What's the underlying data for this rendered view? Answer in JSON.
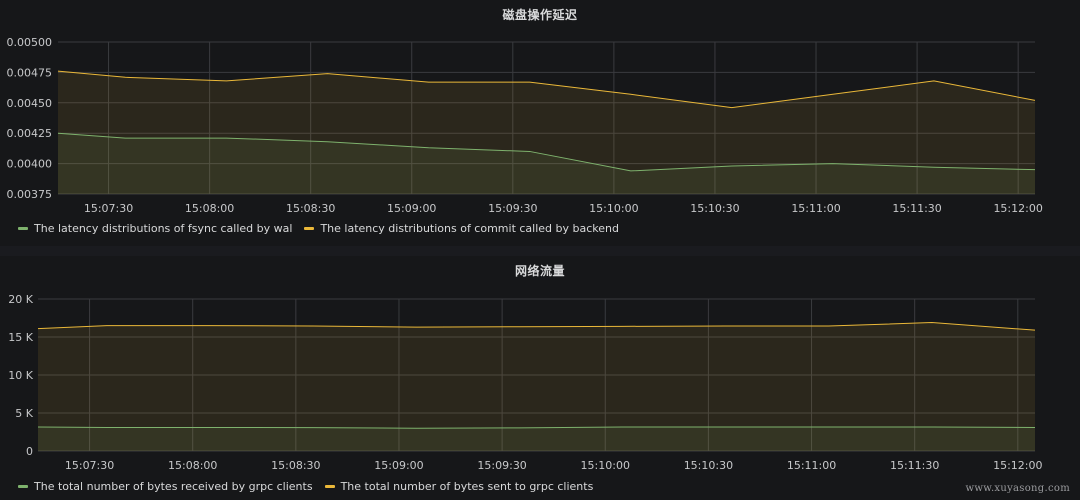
{
  "chart_data": [
    {
      "type": "area",
      "title": "磁盘操作延迟",
      "x": [
        "15:07:15",
        "15:07:30",
        "15:07:45",
        "15:08:00",
        "15:08:15",
        "15:08:30",
        "15:08:45",
        "15:09:00",
        "15:09:15",
        "15:09:30",
        "15:09:45",
        "15:10:00",
        "15:10:15",
        "15:10:30",
        "15:10:45",
        "15:11:00",
        "15:11:15",
        "15:11:30",
        "15:11:45",
        "15:12:00"
      ],
      "x_ticks": [
        "15:07:30",
        "15:08:00",
        "15:08:30",
        "15:09:00",
        "15:09:30",
        "15:10:00",
        "15:10:30",
        "15:11:00",
        "15:11:30",
        "15:12:00"
      ],
      "y_ticks": [
        "0.00500",
        "0.00475",
        "0.00450",
        "0.00425",
        "0.00400",
        "0.00375"
      ],
      "ylim": [
        0.00375,
        0.005
      ],
      "xlabel": "",
      "ylabel": "",
      "grid": true,
      "legend_position": "bottom-left",
      "series": [
        {
          "name": "The latency distributions of fsync called by wal",
          "color": "#7eb26d",
          "points": [
            [
              "15:07:15",
              0.00425
            ],
            [
              "15:07:35",
              0.00421
            ],
            [
              "15:08:05",
              0.00421
            ],
            [
              "15:08:35",
              0.00418
            ],
            [
              "15:09:05",
              0.00413
            ],
            [
              "15:09:35",
              0.0041
            ],
            [
              "15:10:05",
              0.00394
            ],
            [
              "15:10:35",
              0.00398
            ],
            [
              "15:11:05",
              0.004
            ],
            [
              "15:11:35",
              0.00397
            ],
            [
              "15:12:05",
              0.00395
            ]
          ]
        },
        {
          "name": "The latency distributions of commit called by backend",
          "color": "#eab839",
          "points": [
            [
              "15:07:15",
              0.00476
            ],
            [
              "15:07:35",
              0.00471
            ],
            [
              "15:08:05",
              0.00468
            ],
            [
              "15:08:35",
              0.00474
            ],
            [
              "15:09:05",
              0.00467
            ],
            [
              "15:09:35",
              0.00467
            ],
            [
              "15:10:05",
              0.00457
            ],
            [
              "15:10:35",
              0.00446
            ],
            [
              "15:11:05",
              0.00457
            ],
            [
              "15:11:35",
              0.00468
            ],
            [
              "15:12:05",
              0.00452
            ]
          ]
        }
      ]
    },
    {
      "type": "area",
      "title": "网络流量",
      "x_ticks": [
        "15:07:30",
        "15:08:00",
        "15:08:30",
        "15:09:00",
        "15:09:30",
        "15:10:00",
        "15:10:30",
        "15:11:00",
        "15:11:30",
        "15:12:00"
      ],
      "y_ticks": [
        "20 K",
        "15 K",
        "10 K",
        "5 K",
        "0"
      ],
      "ylim": [
        0,
        20000
      ],
      "xlabel": "",
      "ylabel": "",
      "grid": true,
      "legend_position": "bottom-left",
      "series": [
        {
          "name": "The total number of bytes received by grpc clients",
          "color": "#7eb26d",
          "points": [
            [
              "15:07:15",
              3150
            ],
            [
              "15:07:35",
              3100
            ],
            [
              "15:08:05",
              3100
            ],
            [
              "15:08:35",
              3080
            ],
            [
              "15:09:05",
              3000
            ],
            [
              "15:09:35",
              3050
            ],
            [
              "15:10:05",
              3150
            ],
            [
              "15:10:35",
              3150
            ],
            [
              "15:11:05",
              3150
            ],
            [
              "15:11:35",
              3150
            ],
            [
              "15:12:05",
              3100
            ]
          ]
        },
        {
          "name": "The total number of bytes sent to grpc clients",
          "color": "#eab839",
          "points": [
            [
              "15:07:15",
              16100
            ],
            [
              "15:07:35",
              16500
            ],
            [
              "15:08:05",
              16500
            ],
            [
              "15:08:35",
              16450
            ],
            [
              "15:09:05",
              16300
            ],
            [
              "15:09:35",
              16350
            ],
            [
              "15:10:05",
              16400
            ],
            [
              "15:10:35",
              16450
            ],
            [
              "15:11:05",
              16450
            ],
            [
              "15:11:35",
              16900
            ],
            [
              "15:12:05",
              15900
            ]
          ]
        }
      ]
    }
  ],
  "watermark": "www.xuyasong.com"
}
